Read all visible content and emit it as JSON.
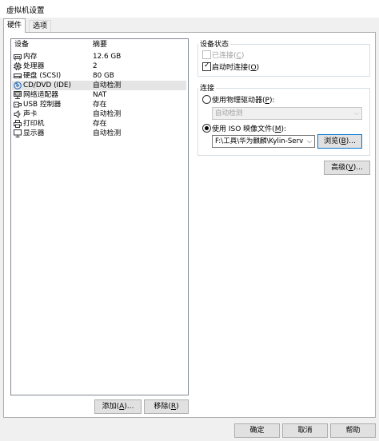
{
  "window": {
    "title": "虚拟机设置"
  },
  "tabs": [
    {
      "label": "硬件",
      "active": true
    },
    {
      "label": "选项",
      "active": false
    }
  ],
  "device_list": {
    "headers": [
      "设备",
      "摘要"
    ],
    "rows": [
      {
        "icon": "memory-icon",
        "name": "内存",
        "summary": "12.6 GB",
        "selected": false
      },
      {
        "icon": "cpu-icon",
        "name": "处理器",
        "summary": "2",
        "selected": false
      },
      {
        "icon": "hard-disk-icon",
        "name": "硬盘 (SCSI)",
        "summary": "80 GB",
        "selected": false
      },
      {
        "icon": "cd-dvd-icon",
        "name": "CD/DVD (IDE)",
        "summary": "自动检测",
        "selected": true
      },
      {
        "icon": "network-adapter-icon",
        "name": "网络适配器",
        "summary": "NAT",
        "selected": false
      },
      {
        "icon": "usb-icon",
        "name": "USB 控制器",
        "summary": "存在",
        "selected": false
      },
      {
        "icon": "sound-card-icon",
        "name": "声卡",
        "summary": "自动检测",
        "selected": false
      },
      {
        "icon": "printer-icon",
        "name": "打印机",
        "summary": "存在",
        "selected": false
      },
      {
        "icon": "display-icon",
        "name": "显示器",
        "summary": "自动检测",
        "selected": false
      }
    ],
    "add_button": {
      "text": "添加(",
      "key": "A",
      "suffix": ")..."
    },
    "remove_button": {
      "text": "移除(",
      "key": "R",
      "suffix": ")"
    }
  },
  "device_status": {
    "title": "设备状态",
    "connected": {
      "text": "已连接(",
      "key": "C",
      "suffix": ")",
      "checked": false,
      "disabled": true
    },
    "connect_at_power_on": {
      "text": "启动时连接(",
      "key": "O",
      "suffix": ")",
      "checked": true,
      "disabled": false
    }
  },
  "connection": {
    "title": "连接",
    "physical_drive": {
      "text": "使用物理驱动器(",
      "key": "P",
      "suffix": "):",
      "selected": false
    },
    "physical_drive_value": "自动检测",
    "iso_image": {
      "text": "使用 ISO 映像文件(",
      "key": "M",
      "suffix": "):",
      "selected": true
    },
    "iso_path": "F:\\工具\\华为麒麟\\Kylin-Server-",
    "browse_button": {
      "text": "浏览(",
      "key": "B",
      "suffix": ")..."
    }
  },
  "advanced_button": {
    "text": "高级(",
    "key": "V",
    "suffix": ")..."
  },
  "footer": {
    "ok": "确定",
    "cancel": "取消",
    "help": "帮助"
  }
}
